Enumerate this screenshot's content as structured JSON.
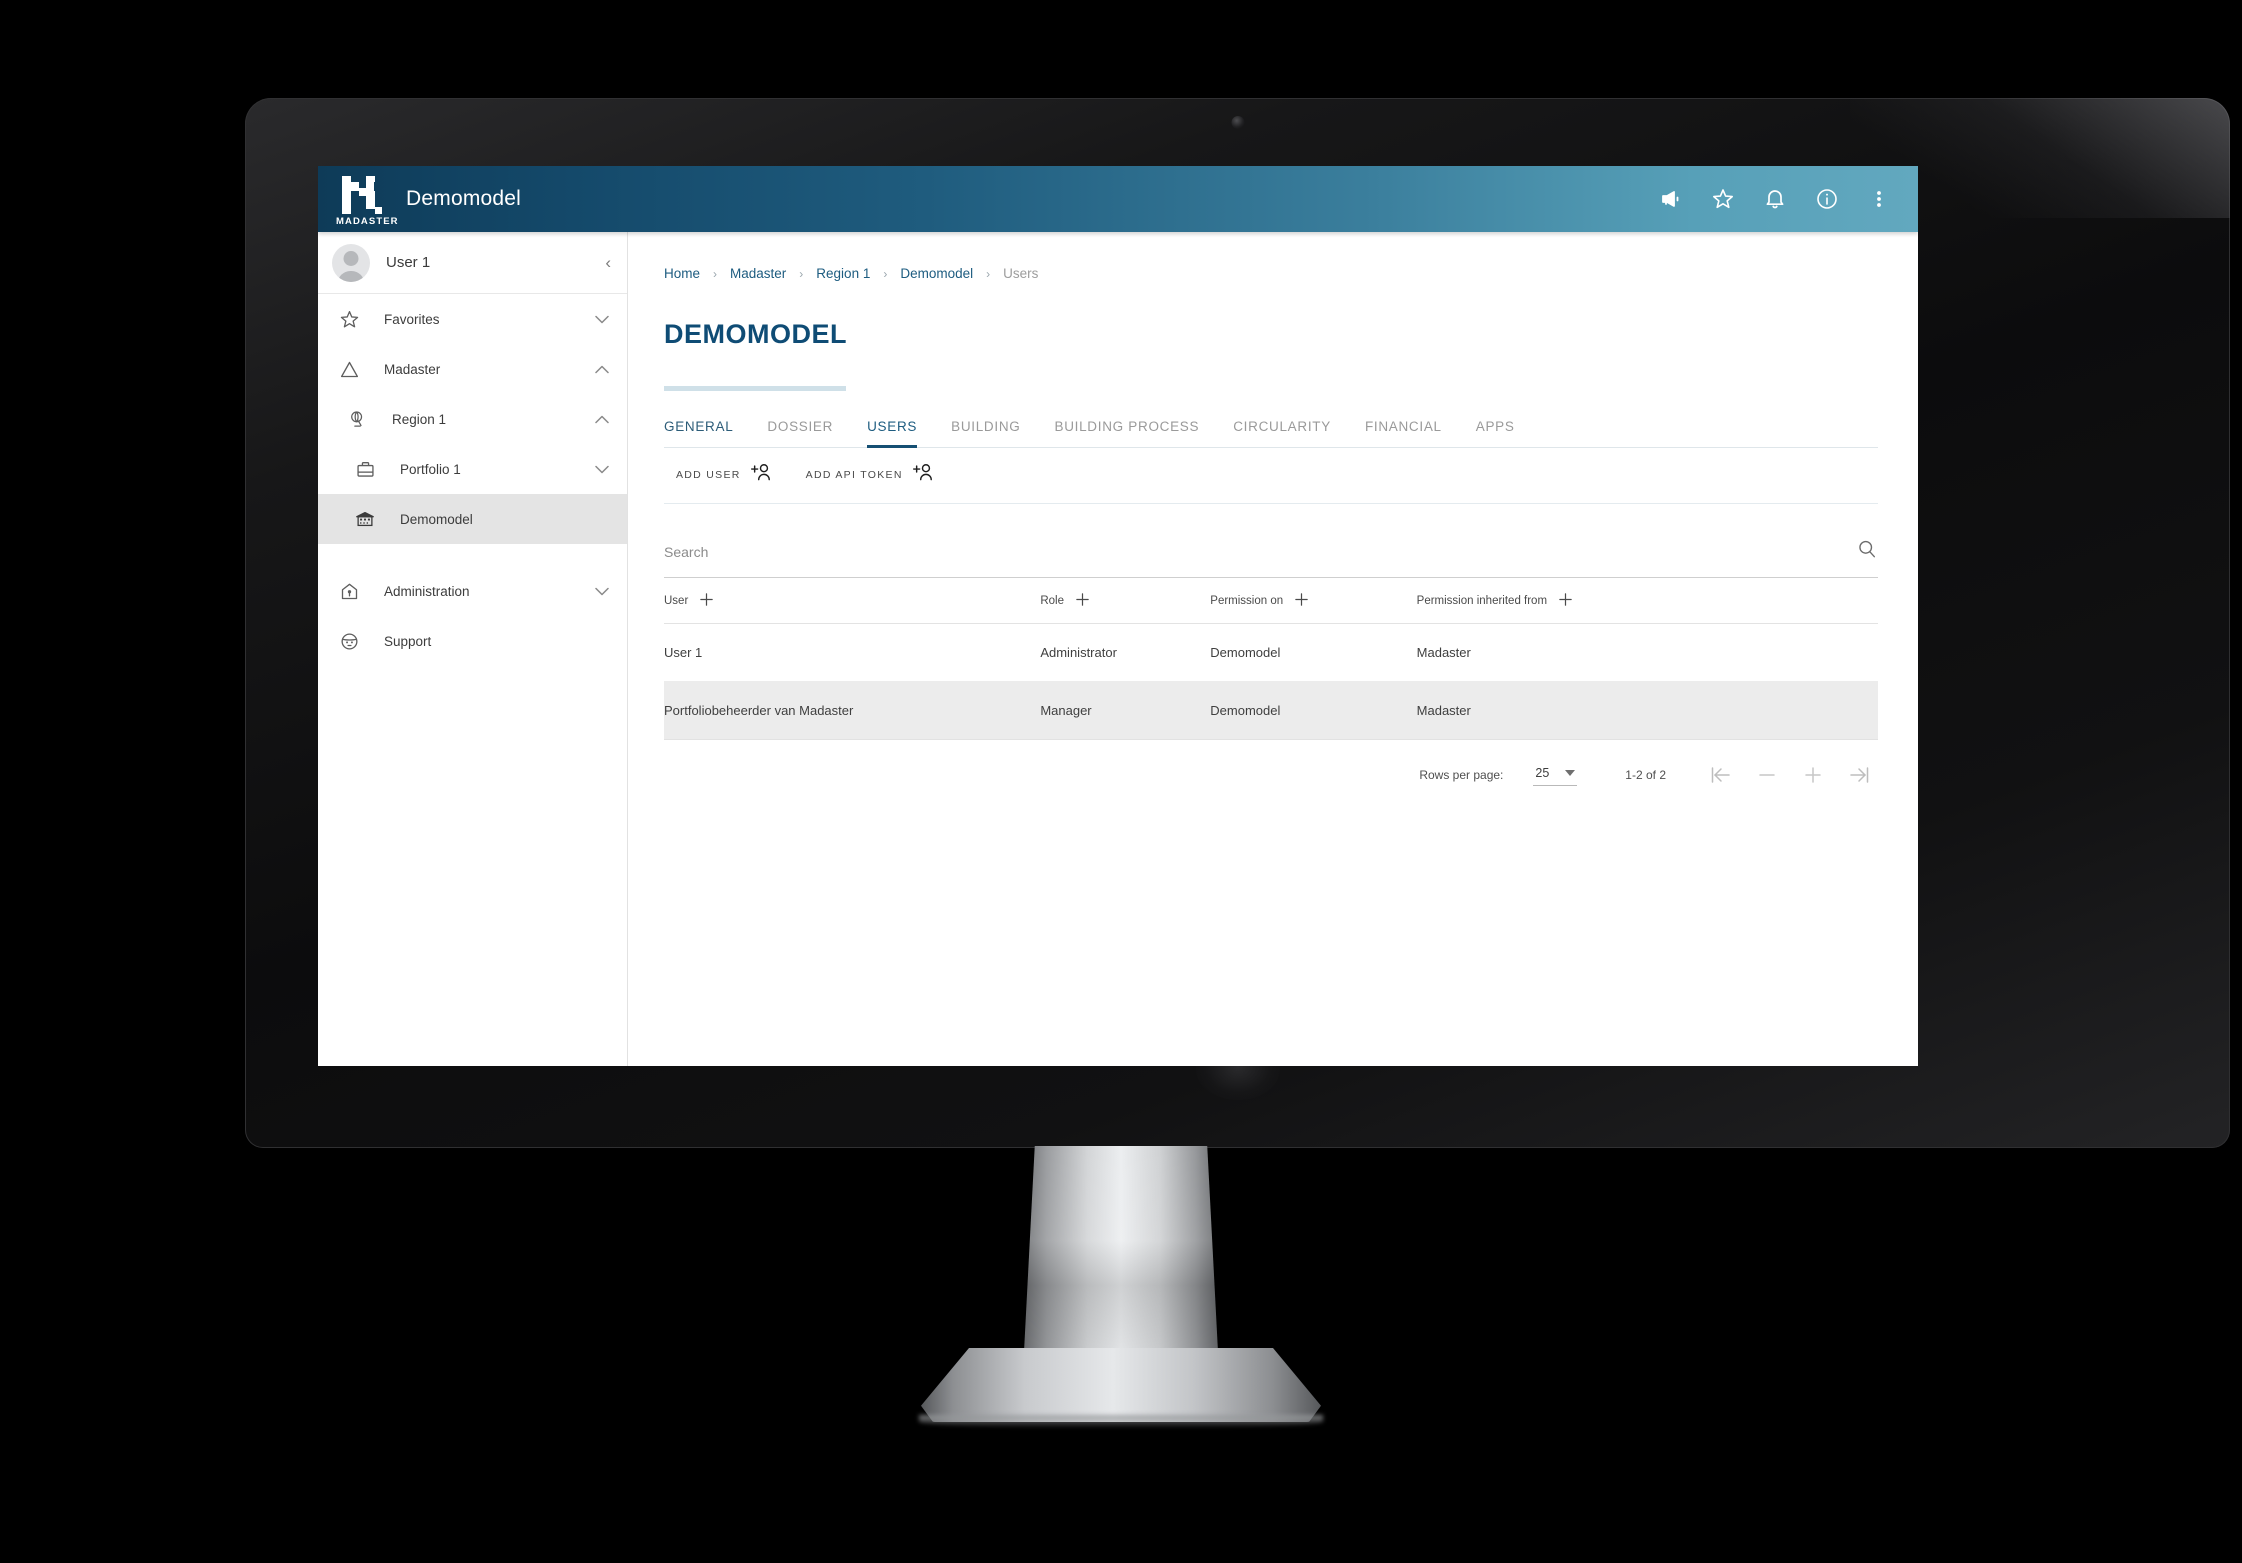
{
  "app": {
    "brand_name": "MADASTER",
    "title": "Demomodel",
    "header_gradient_from": "#0e3b58",
    "header_gradient_to": "#62a8bf",
    "accent_color": "#1d5c80"
  },
  "header_icons": [
    {
      "name": "megaphone-icon",
      "label": "Announcements"
    },
    {
      "name": "star-icon",
      "label": "Favorites"
    },
    {
      "name": "bell-icon",
      "label": "Notifications"
    },
    {
      "name": "info-icon",
      "label": "Information"
    },
    {
      "name": "more-vertical-icon",
      "label": "More options"
    }
  ],
  "sidebar": {
    "user": {
      "name": "User 1",
      "collapse_glyph": "‹"
    },
    "items": [
      {
        "label": "Favorites",
        "icon": "star-icon",
        "level": 0,
        "chevron": "down",
        "active": false
      },
      {
        "label": "Madaster",
        "icon": "triangle-icon",
        "level": 0,
        "chevron": "up",
        "active": false
      },
      {
        "label": "Region 1",
        "icon": "globe-icon",
        "level": 1,
        "chevron": "up",
        "active": false
      },
      {
        "label": "Portfolio 1",
        "icon": "briefcase-icon",
        "level": 2,
        "chevron": "down",
        "active": false
      },
      {
        "label": "Demomodel",
        "icon": "building-icon",
        "level": 2,
        "chevron": "none",
        "active": true
      },
      {
        "label": "Administration",
        "icon": "house-key-icon",
        "level": 0,
        "chevron": "down",
        "active": false
      },
      {
        "label": "Support",
        "icon": "support-face-icon",
        "level": 0,
        "chevron": "none",
        "active": false
      }
    ]
  },
  "breadcrumb": [
    {
      "label": "Home",
      "current": false
    },
    {
      "label": "Madaster",
      "current": false
    },
    {
      "label": "Region 1",
      "current": false
    },
    {
      "label": "Demomodel",
      "current": false
    },
    {
      "label": "Users",
      "current": true
    }
  ],
  "breadcrumb_separator": "›",
  "page": {
    "title": "DEMOMODEL"
  },
  "tabs": [
    {
      "label": "GENERAL",
      "state": "dark"
    },
    {
      "label": "DOSSIER",
      "state": "normal"
    },
    {
      "label": "USERS",
      "state": "active"
    },
    {
      "label": "BUILDING",
      "state": "normal"
    },
    {
      "label": "BUILDING PROCESS",
      "state": "normal"
    },
    {
      "label": "CIRCULARITY",
      "state": "normal"
    },
    {
      "label": "FINANCIAL",
      "state": "normal"
    },
    {
      "label": "APPS",
      "state": "normal"
    }
  ],
  "actions": [
    {
      "label": "ADD USER",
      "icon": "person-add-icon"
    },
    {
      "label": "ADD API TOKEN",
      "icon": "person-add-icon"
    }
  ],
  "search": {
    "placeholder": "Search",
    "value": "",
    "icon": "search-icon"
  },
  "table": {
    "columns": [
      {
        "label": "User",
        "add_icon": "plus-icon"
      },
      {
        "label": "Role",
        "add_icon": "plus-icon"
      },
      {
        "label": "Permission on",
        "add_icon": "plus-icon"
      },
      {
        "label": "Permission inherited from",
        "add_icon": "plus-icon"
      }
    ],
    "rows": [
      {
        "user": "User 1",
        "role": "Administrator",
        "permission_on": "Demomodel",
        "permission_inherited_from": "Madaster"
      },
      {
        "user": "Portfoliobeheerder van Madaster",
        "role": "Manager",
        "permission_on": "Demomodel",
        "permission_inherited_from": "Madaster"
      }
    ]
  },
  "pagination": {
    "rows_per_page_label": "Rows per page:",
    "rows_per_page_value": "25",
    "rows_per_page_options": [
      "25"
    ],
    "range_text": "1-2 of 2",
    "buttons": [
      {
        "name": "first-page-button",
        "icon": "first-page-icon"
      },
      {
        "name": "previous-page-button",
        "icon": "minus-icon"
      },
      {
        "name": "next-page-button",
        "icon": "plus-icon"
      },
      {
        "name": "last-page-button",
        "icon": "last-page-icon"
      }
    ]
  }
}
